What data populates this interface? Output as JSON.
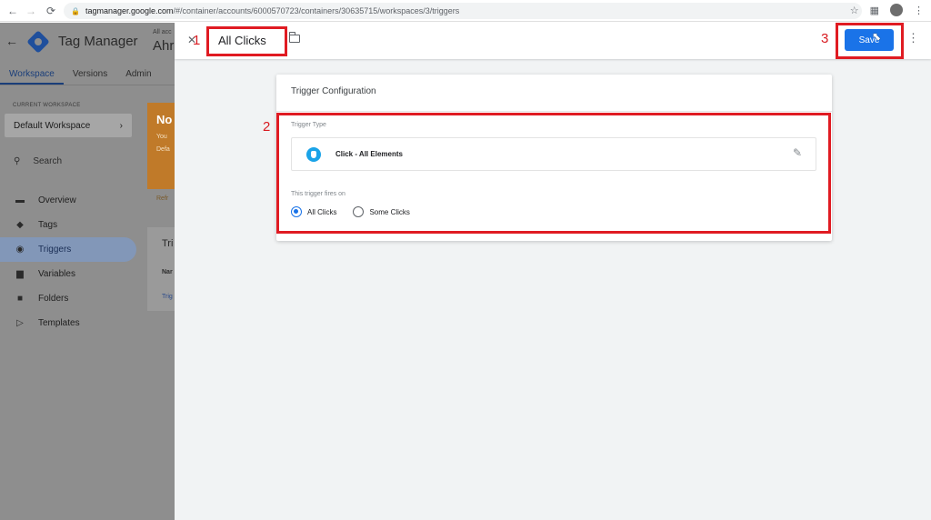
{
  "browser": {
    "url_host": "tagmanager.google.com",
    "url_path": "/#/container/accounts/6000570723/containers/30635715/workspaces/3/triggers"
  },
  "app": {
    "title": "Tag Manager",
    "account_mini": "All acc",
    "account_name": "Ahr",
    "tabs": [
      "Workspace",
      "Versions",
      "Admin"
    ],
    "workspace_label": "CURRENT WORKSPACE",
    "workspace_name": "Default Workspace",
    "search_label": "Search",
    "nav": [
      {
        "label": "Overview",
        "icon": "overview-icon"
      },
      {
        "label": "Tags",
        "icon": "tag-icon"
      },
      {
        "label": "Triggers",
        "icon": "trigger-icon"
      },
      {
        "label": "Variables",
        "icon": "variables-icon"
      },
      {
        "label": "Folders",
        "icon": "folder-icon"
      },
      {
        "label": "Templates",
        "icon": "template-icon"
      }
    ],
    "notice": {
      "title": "No",
      "line1": "You",
      "line2": "Defa",
      "link": "Refr"
    },
    "trigger_card": {
      "title": "Tri",
      "col": "Nar",
      "link": "Trig"
    }
  },
  "editor": {
    "trigger_name": "All Clicks",
    "save_label": "Save",
    "config_title": "Trigger Configuration",
    "type_label": "Trigger Type",
    "type_name": "Click - All Elements",
    "fires_label": "This trigger fires on",
    "options": [
      "All Clicks",
      "Some Clicks"
    ],
    "selected_option": "All Clicks"
  },
  "annotations": {
    "one": "1",
    "two": "2",
    "three": "3"
  },
  "colors": {
    "accent": "#1a73e8",
    "highlight": "#e01b22",
    "click_icon": "#1aa3e8"
  }
}
